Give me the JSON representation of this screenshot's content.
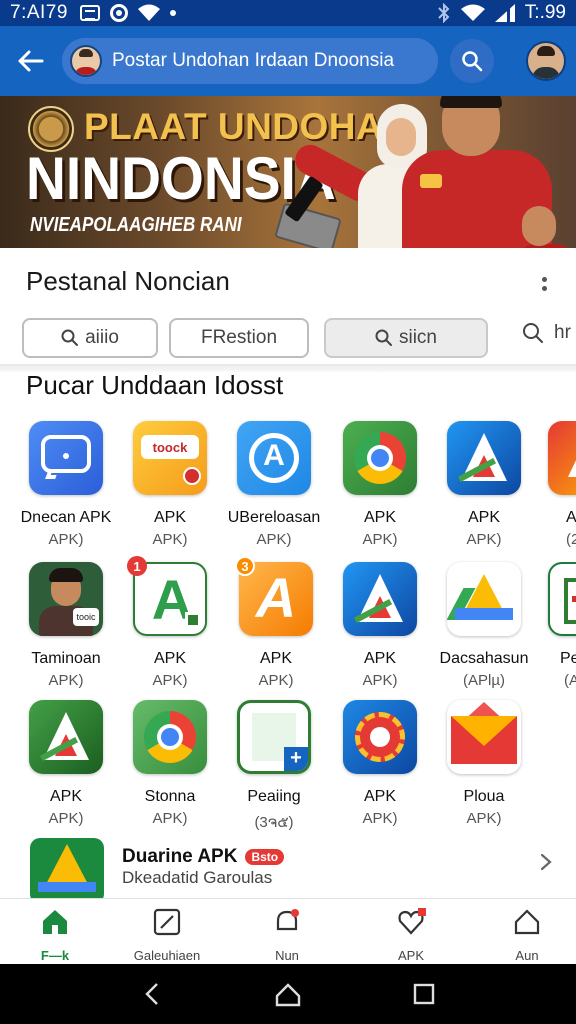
{
  "status_bar": {
    "time": "7:AI79",
    "right_time": "T:.99",
    "icons": [
      "box-icon",
      "circle-icon",
      "wifi-icon",
      "dot-icon",
      "bluetooth-icon",
      "wifi-icon",
      "signal-icon"
    ]
  },
  "app_bar": {
    "search_text": "Postar Undohan Irdaan Dnoonsia"
  },
  "banner": {
    "title_line1": "PLAAT UNDOHAN",
    "title_line2": "NINDONSIA",
    "subtitle": "NVIEAPOLAAGIHEB RANI"
  },
  "section1": {
    "title": "Pestanal Noncian",
    "chips": [
      "aiiio",
      "FRestion",
      "siicn",
      "hr"
    ]
  },
  "section2": {
    "title": "Pucar Unddaan Idosst"
  },
  "apps": [
    {
      "name": "Dnecan APK",
      "sub": "APK)",
      "icon": "chat-icon"
    },
    {
      "name": "APK",
      "sub": "APK)",
      "icon": "toock-icon",
      "icon_text": "toock"
    },
    {
      "name": "UBereloasan",
      "sub": "APK)",
      "icon": "app-store-icon"
    },
    {
      "name": "APK",
      "sub": "APK)",
      "icon": "chrome-icon"
    },
    {
      "name": "APK",
      "sub": "APK)",
      "icon": "a-logo-icon"
    },
    {
      "name": "A",
      "sub": "(2",
      "icon": "edge-icon"
    },
    {
      "name": "Taminoan",
      "sub": "APK)",
      "icon": "photo-icon",
      "icon_text": "tooic"
    },
    {
      "name": "APK",
      "sub": "APK)",
      "icon": "green-a-icon",
      "badge": "1"
    },
    {
      "name": "APK",
      "sub": "APK)",
      "icon": "orange-a-icon",
      "badge": "3"
    },
    {
      "name": "APK",
      "sub": "APK)",
      "icon": "a-logo-icon"
    },
    {
      "name": "Dacsahasun",
      "sub": "(APlµ)",
      "icon": "drive-icon"
    },
    {
      "name": "Pe",
      "sub": "(A",
      "icon": "sheet-icon"
    },
    {
      "name": "APK",
      "sub": "APK)",
      "icon": "a-logo-icon"
    },
    {
      "name": "Stonna",
      "sub": "APK)",
      "icon": "chrome-icon"
    },
    {
      "name": "Peaiing",
      "sub": "(3ຈ๕)",
      "icon": "sheets-plus-icon",
      "icon_text": "+"
    },
    {
      "name": "APK",
      "sub": "APK)",
      "icon": "gear-icon"
    },
    {
      "name": "Ploua",
      "sub": "APK)",
      "icon": "envelope-icon"
    }
  ],
  "featured": {
    "title": "Duarine APK",
    "badge": "Bsto",
    "subtitle": "Dkeadatid Garoulas"
  },
  "bottom_nav": [
    {
      "label": "F—k",
      "icon": "home-icon",
      "active": true
    },
    {
      "label": "Galeuhiaen",
      "icon": "edit-icon"
    },
    {
      "label": "Nun",
      "icon": "bell-icon"
    },
    {
      "label": "APK",
      "icon": "heart-icon"
    },
    {
      "label": "Aun",
      "icon": "house-outline-icon"
    }
  ],
  "colors": {
    "app_bar": "#1565c0",
    "status_bar": "#0a3a8c",
    "nav_active": "#1b8a3f"
  }
}
